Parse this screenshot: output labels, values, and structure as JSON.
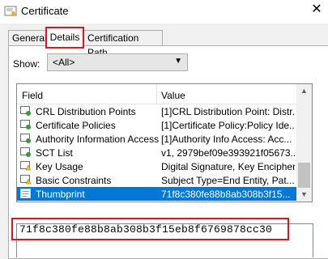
{
  "window": {
    "title": "Certificate",
    "app_icon": "certificate-icon",
    "close_icon": "close-icon"
  },
  "tabs": [
    {
      "label": "General",
      "selected": false
    },
    {
      "label": "Details",
      "selected": true
    },
    {
      "label": "Certification Path",
      "selected": false
    }
  ],
  "show": {
    "label": "Show:",
    "selected": "<All>"
  },
  "list": {
    "columns": {
      "field": "Field",
      "value": "Value"
    },
    "rows": [
      {
        "field": "CRL Distribution Points",
        "value": "[1]CRL Distribution Point: Distr...",
        "icon": "extension-icon",
        "selected": false
      },
      {
        "field": "Certificate Policies",
        "value": "[1]Certificate Policy:Policy Ide...",
        "icon": "extension-icon",
        "selected": false
      },
      {
        "field": "Authority Information Access",
        "value": "[1]Authority Info Access: Acc...",
        "icon": "extension-icon",
        "selected": false
      },
      {
        "field": "SCT List",
        "value": "v1, 2979bef09e393921f05673...",
        "icon": "extension-icon",
        "selected": false
      },
      {
        "field": "Key Usage",
        "value": "Digital Signature, Key Encipher...",
        "icon": "critical-extension-icon",
        "selected": false
      },
      {
        "field": "Basic Constraints",
        "value": "Subject Type=End Entity, Pat...",
        "icon": "critical-extension-icon",
        "selected": false
      },
      {
        "field": "Thumbprint",
        "value": "71f8c380fe88b8ab308b3f15...",
        "icon": "property-icon",
        "selected": true
      }
    ]
  },
  "detail_value": "71f8c380fe88b8ab308b3f15eb8f6769878cc30",
  "colors": {
    "selection": "#0078d7",
    "highlight_box": "#e4131b"
  }
}
